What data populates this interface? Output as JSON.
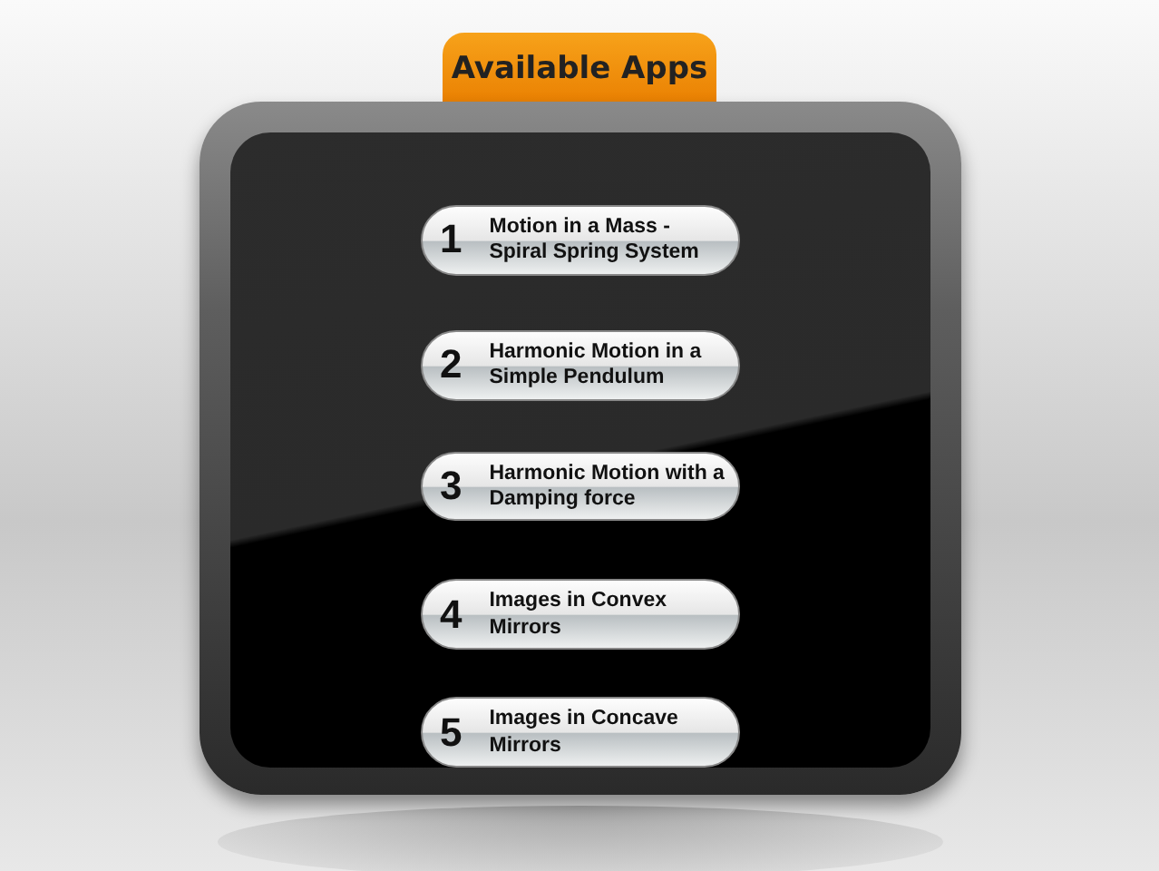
{
  "header_tab": {
    "title": "Available Apps"
  },
  "apps": [
    {
      "number": "1",
      "title": "Motion in a Mass - Spiral Spring System"
    },
    {
      "number": "2",
      "title": "Harmonic Motion in a Simple Pendulum"
    },
    {
      "number": "3",
      "title": "Harmonic Motion with a Damping force"
    },
    {
      "number": "4",
      "title": "Images in Convex Mirrors"
    },
    {
      "number": "5",
      "title": "Images in Concave Mirrors"
    }
  ]
}
